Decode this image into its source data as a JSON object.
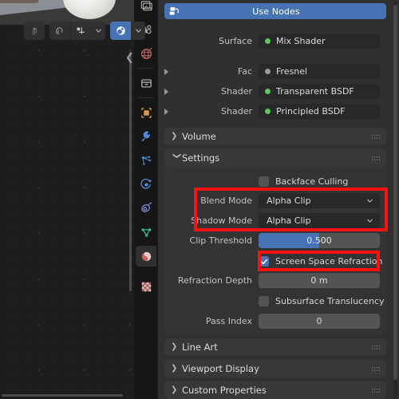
{
  "app": {
    "name": "Blender",
    "accent_blue": "#4772b3",
    "panel_bg": "#303030",
    "field_bg": "#282828",
    "annotation_red": "#fc1010"
  },
  "viewport": {
    "name": "3d-viewport",
    "toolbar": {
      "buttons": [
        {
          "name": "snap-parent-button",
          "icon": "arrow-up-curve-icon",
          "active": false
        },
        {
          "name": "proportional-edit-button",
          "icon": "magnet-icon",
          "active": false
        },
        {
          "name": "snap-to-button",
          "icon": "snap-grid-icon",
          "active": false
        },
        {
          "name": "snap-dropdown",
          "icon": "chevron-down-icon",
          "active": false
        },
        {
          "name": "proportional-editing-button",
          "icon": "proportional-falloff-icon",
          "active": true
        },
        {
          "name": "falloff-dropdown",
          "icon": "chevron-down-icon",
          "active": false
        }
      ]
    },
    "collapse_arrow_icon": "chevron-left-icon"
  },
  "tabrail": {
    "name": "properties-tab-rail",
    "tabs": [
      {
        "name": "tab-render",
        "icon": "camera-back-icon",
        "color": "#b8b8b8",
        "active": false
      },
      {
        "name": "tab-output",
        "icon": "printer-icon",
        "color": "#b8b8b8",
        "active": false
      },
      {
        "name": "tab-view-layer",
        "icon": "images-icon",
        "color": "#b8b8b8",
        "active": false
      },
      {
        "name": "tab-scene",
        "icon": "cone-sphere-icon",
        "color": "#b8b8b8",
        "active": false
      },
      {
        "name": "tab-world",
        "icon": "world-globe-icon",
        "color": "#c06464",
        "active": false
      },
      {
        "name": "tab-collection",
        "icon": "box-collection-icon",
        "color": "#b8b8b8",
        "active": false
      },
      {
        "name": "tab-object",
        "icon": "object-square-icon",
        "color": "#d79b4c",
        "active": false
      },
      {
        "name": "tab-modifiers",
        "icon": "wrench-icon",
        "color": "#5288d8",
        "active": false
      },
      {
        "name": "tab-particles",
        "icon": "particles-icon",
        "color": "#5288d8",
        "active": false
      },
      {
        "name": "tab-physics",
        "icon": "physics-orbit-icon",
        "color": "#5288d8",
        "active": false
      },
      {
        "name": "tab-constraints",
        "icon": "constraint-clamp-icon",
        "color": "#7f8fd6",
        "active": false
      },
      {
        "name": "tab-object-data",
        "icon": "mesh-triangle-icon",
        "color": "#3fbf8f",
        "active": false
      },
      {
        "name": "tab-material",
        "icon": "material-sphere-icon",
        "color": "#c06464",
        "active": true
      },
      {
        "name": "tab-texture",
        "icon": "checker-texture-icon",
        "color": "#c06464",
        "active": false
      }
    ]
  },
  "properties": {
    "use_nodes": {
      "label": "Use Nodes",
      "icon": "node-tree-icon",
      "enabled": true
    },
    "surface_rows": [
      {
        "label": "Surface",
        "value": "Mix Shader",
        "dot_color": "#5ec45e",
        "has_expand": false
      },
      {
        "label": "Fac",
        "value": "Fresnel",
        "dot_color": "#9a9a9a",
        "has_expand": true
      },
      {
        "label": "Shader",
        "value": "Transparent BSDF",
        "dot_color": "#5ec45e",
        "has_expand": true
      },
      {
        "label": "Shader",
        "value": "Principled BSDF",
        "dot_color": "#5ec45e",
        "has_expand": true
      }
    ],
    "panels": [
      {
        "name": "volume",
        "title": "Volume",
        "expanded": false
      },
      {
        "name": "settings",
        "title": "Settings",
        "expanded": true
      },
      {
        "name": "line-art",
        "title": "Line Art",
        "expanded": false
      },
      {
        "name": "viewport-display",
        "title": "Viewport Display",
        "expanded": false
      },
      {
        "name": "custom-properties",
        "title": "Custom Properties",
        "expanded": false
      }
    ],
    "settings": {
      "backface_culling": {
        "label": "Backface Culling",
        "checked": false
      },
      "blend_mode": {
        "label": "Blend Mode",
        "value": "Alpha Clip",
        "highlighted": true
      },
      "shadow_mode": {
        "label": "Shadow Mode",
        "value": "Alpha Clip",
        "highlighted": true
      },
      "clip_threshold": {
        "label": "Clip Threshold",
        "value": "0.500",
        "fill_percent": 50
      },
      "screen_space_refraction": {
        "label": "Screen Space Refraction",
        "checked": true,
        "highlighted": true
      },
      "refraction_depth": {
        "label": "Refraction Depth",
        "value": "0 m"
      },
      "subsurface_translucency": {
        "label": "Subsurface Translucency",
        "checked": false
      },
      "pass_index": {
        "label": "Pass Index",
        "value": "0"
      }
    }
  },
  "annotations": [
    {
      "name": "annotation-blend-shadow-mode",
      "target": "blend-and-shadow-mode"
    },
    {
      "name": "annotation-screen-space-refraction",
      "target": "screen-space-refraction"
    }
  ]
}
